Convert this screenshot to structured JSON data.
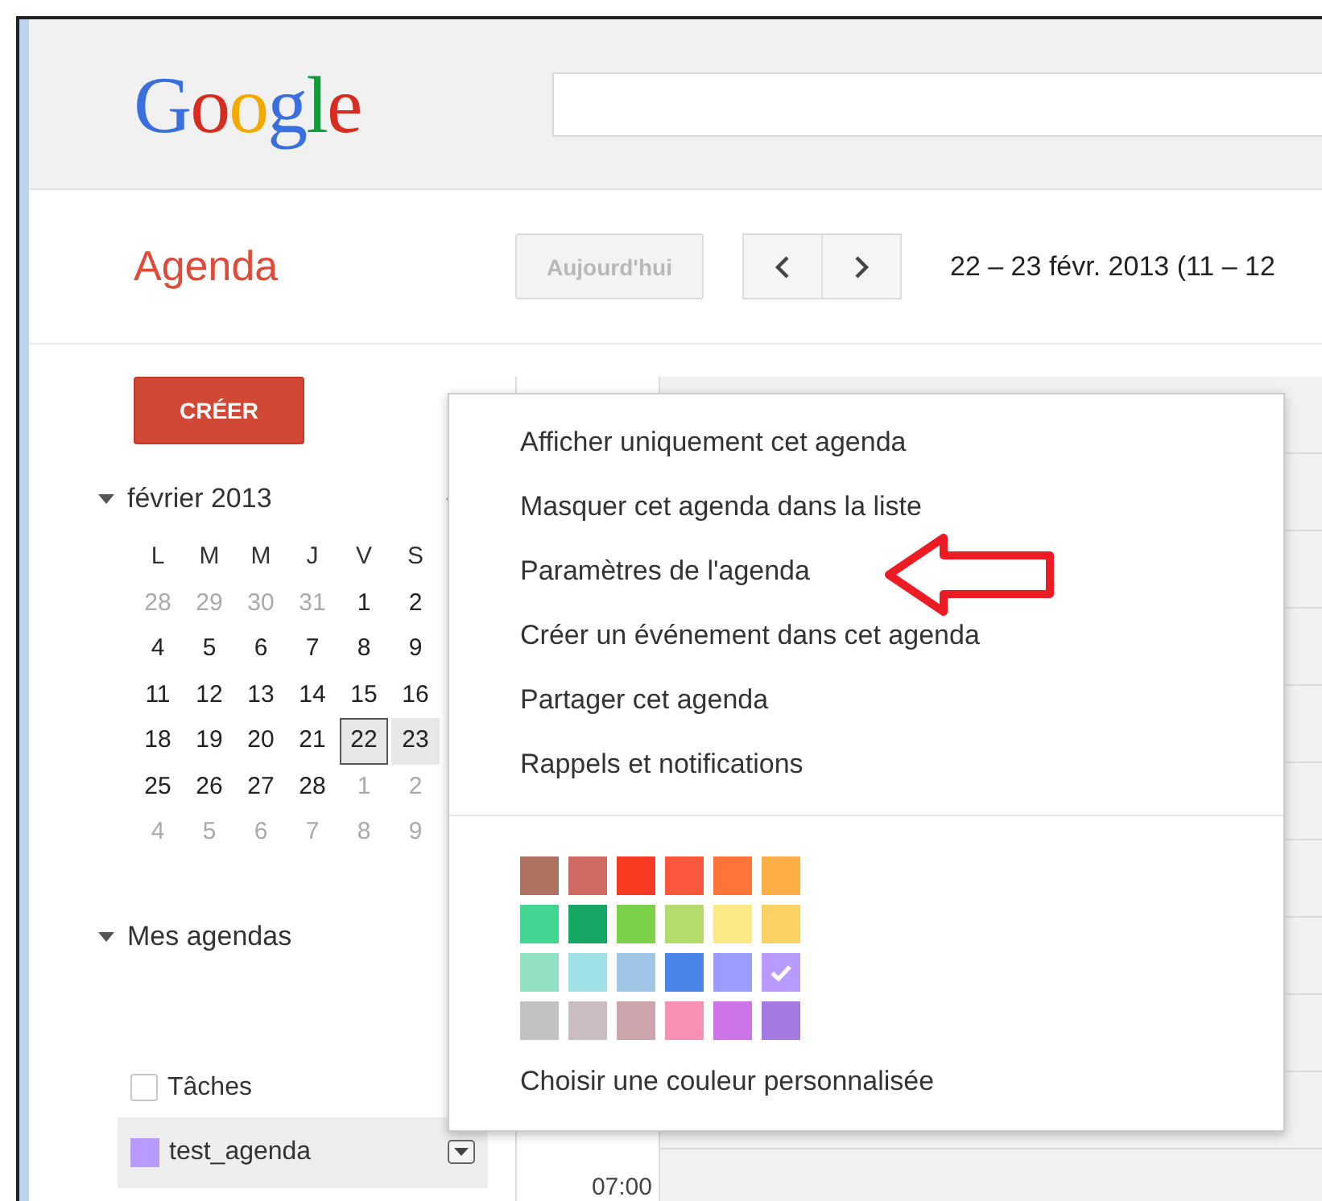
{
  "header": {
    "logo": "Google"
  },
  "toolbar": {
    "title": "Agenda",
    "today_button": "Aujourd'hui",
    "date_range": "22 – 23 févr. 2013 (11 – 12"
  },
  "sidebar": {
    "create_button": "CRÉER",
    "mini_calendar": {
      "month": "février 2013",
      "weekdays": [
        "L",
        "M",
        "M",
        "J",
        "V",
        "S"
      ],
      "weeks": [
        [
          {
            "day": "28",
            "other_month": true,
            "selected": false,
            "today": false
          },
          {
            "day": "29",
            "other_month": true,
            "selected": false,
            "today": false
          },
          {
            "day": "30",
            "other_month": true,
            "selected": false,
            "today": false
          },
          {
            "day": "31",
            "other_month": true,
            "selected": false,
            "today": false
          },
          {
            "day": "1",
            "other_month": false,
            "selected": false,
            "today": false
          },
          {
            "day": "2",
            "other_month": false,
            "selected": false,
            "today": false
          }
        ],
        [
          {
            "day": "4",
            "other_month": false,
            "selected": false,
            "today": false
          },
          {
            "day": "5",
            "other_month": false,
            "selected": false,
            "today": false
          },
          {
            "day": "6",
            "other_month": false,
            "selected": false,
            "today": false
          },
          {
            "day": "7",
            "other_month": false,
            "selected": false,
            "today": false
          },
          {
            "day": "8",
            "other_month": false,
            "selected": false,
            "today": false
          },
          {
            "day": "9",
            "other_month": false,
            "selected": false,
            "today": false
          }
        ],
        [
          {
            "day": "11",
            "other_month": false,
            "selected": false,
            "today": false
          },
          {
            "day": "12",
            "other_month": false,
            "selected": false,
            "today": false
          },
          {
            "day": "13",
            "other_month": false,
            "selected": false,
            "today": false
          },
          {
            "day": "14",
            "other_month": false,
            "selected": false,
            "today": false
          },
          {
            "day": "15",
            "other_month": false,
            "selected": false,
            "today": false
          },
          {
            "day": "16",
            "other_month": false,
            "selected": false,
            "today": false
          }
        ],
        [
          {
            "day": "18",
            "other_month": false,
            "selected": false,
            "today": false
          },
          {
            "day": "19",
            "other_month": false,
            "selected": false,
            "today": false
          },
          {
            "day": "20",
            "other_month": false,
            "selected": false,
            "today": false
          },
          {
            "day": "21",
            "other_month": false,
            "selected": false,
            "today": false
          },
          {
            "day": "22",
            "other_month": false,
            "selected": true,
            "today": true
          },
          {
            "day": "23",
            "other_month": false,
            "selected": true,
            "today": false
          }
        ],
        [
          {
            "day": "25",
            "other_month": false,
            "selected": false,
            "today": false
          },
          {
            "day": "26",
            "other_month": false,
            "selected": false,
            "today": false
          },
          {
            "day": "27",
            "other_month": false,
            "selected": false,
            "today": false
          },
          {
            "day": "28",
            "other_month": false,
            "selected": false,
            "today": false
          },
          {
            "day": "1",
            "other_month": true,
            "selected": false,
            "today": false
          },
          {
            "day": "2",
            "other_month": true,
            "selected": false,
            "today": false
          }
        ],
        [
          {
            "day": "4",
            "other_month": true,
            "selected": false,
            "today": false
          },
          {
            "day": "5",
            "other_month": true,
            "selected": false,
            "today": false
          },
          {
            "day": "6",
            "other_month": true,
            "selected": false,
            "today": false
          },
          {
            "day": "7",
            "other_month": true,
            "selected": false,
            "today": false
          },
          {
            "day": "8",
            "other_month": true,
            "selected": false,
            "today": false
          },
          {
            "day": "9",
            "other_month": true,
            "selected": false,
            "today": false
          }
        ]
      ]
    },
    "my_calendars": {
      "title": "Mes agendas",
      "items": [
        {
          "label": "Tâches",
          "kind": "checkbox",
          "checked": false
        },
        {
          "label": "test_agenda",
          "kind": "swatch",
          "color": "#b99aff"
        }
      ]
    }
  },
  "grid": {
    "time_label": "07:00"
  },
  "context_menu": {
    "items": [
      "Afficher uniquement cet agenda",
      "Masquer cet agenda dans la liste",
      "Paramètres de l'agenda",
      "Créer un événement dans cet agenda",
      "Partager cet agenda",
      "Rappels et notifications"
    ],
    "colors": [
      {
        "color": "#ac725e",
        "selected": false
      },
      {
        "color": "#d06b64",
        "selected": false
      },
      {
        "color": "#f83a22",
        "selected": false
      },
      {
        "color": "#fa573c",
        "selected": false
      },
      {
        "color": "#ff7537",
        "selected": false
      },
      {
        "color": "#ffad46",
        "selected": false
      },
      {
        "color": "#42d692",
        "selected": false
      },
      {
        "color": "#16a765",
        "selected": false
      },
      {
        "color": "#7bd148",
        "selected": false
      },
      {
        "color": "#b3dc6c",
        "selected": false
      },
      {
        "color": "#fbe983",
        "selected": false
      },
      {
        "color": "#fad165",
        "selected": false
      },
      {
        "color": "#92e1c0",
        "selected": false
      },
      {
        "color": "#9fe1e7",
        "selected": false
      },
      {
        "color": "#9fc6e7",
        "selected": false
      },
      {
        "color": "#4986e7",
        "selected": false
      },
      {
        "color": "#9a9cff",
        "selected": false
      },
      {
        "color": "#b99aff",
        "selected": true
      },
      {
        "color": "#c2c2c2",
        "selected": false
      },
      {
        "color": "#cabdbf",
        "selected": false
      },
      {
        "color": "#cca6ac",
        "selected": false
      },
      {
        "color": "#f691b2",
        "selected": false
      },
      {
        "color": "#cd74e6",
        "selected": false
      },
      {
        "color": "#a47ae2",
        "selected": false
      }
    ],
    "custom_color": "Choisir une couleur personnalisée"
  }
}
